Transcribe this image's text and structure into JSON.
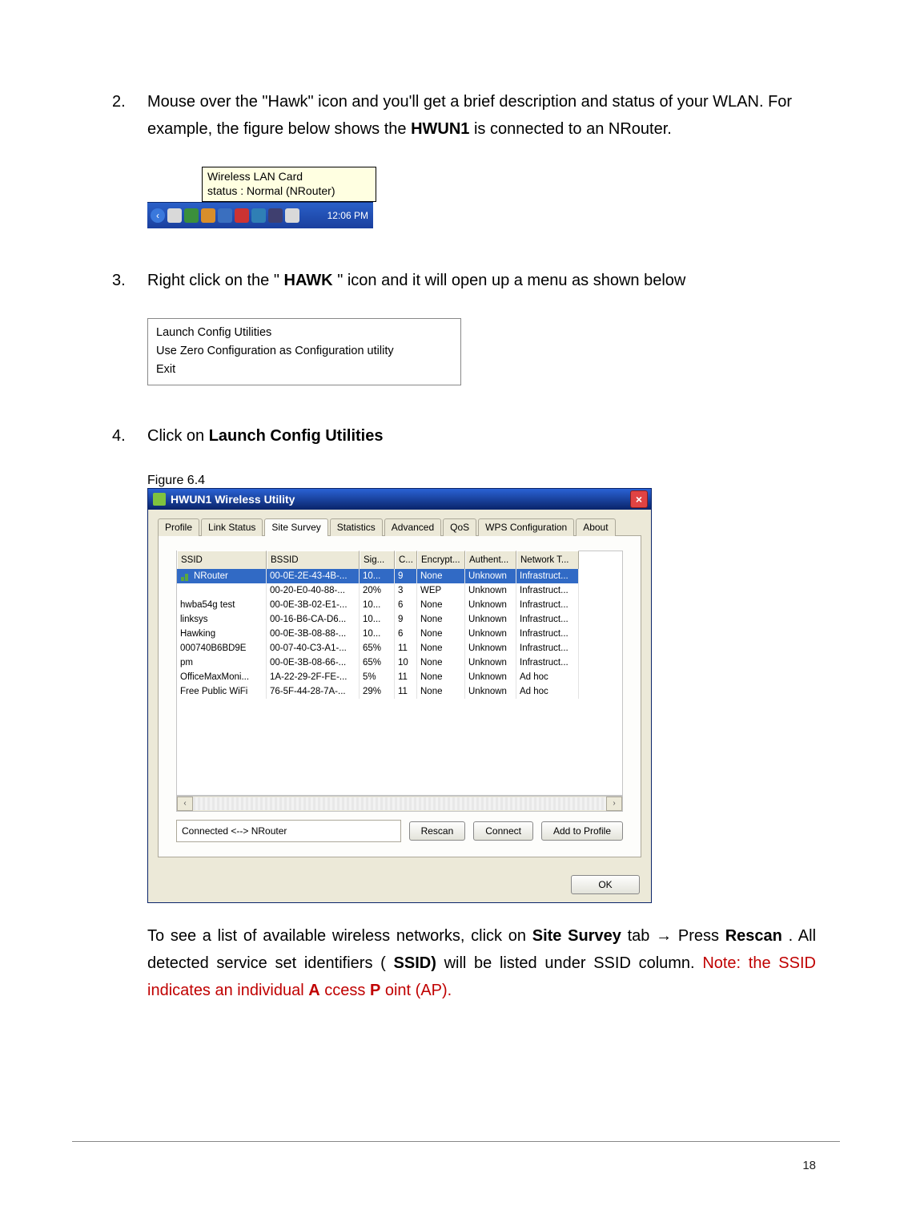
{
  "steps": {
    "s2": {
      "num": "2.",
      "text_a": "Mouse over the \"Hawk\" icon and you'll get a brief description and status of your WLAN.  For example, the figure below shows the ",
      "bold": "HWUN1",
      "text_b": " is connected to an NRouter."
    },
    "s3": {
      "num": "3.",
      "text_a": "Right click on the \"",
      "bold": "HAWK",
      "text_b": "\" icon and it will open up a menu as shown below"
    },
    "s4": {
      "num": "4.",
      "text_a": "Click on ",
      "bold": "Launch Config Utilities"
    }
  },
  "tooltip": {
    "line1": "Wireless LAN Card",
    "line2": "status : Normal (NRouter)"
  },
  "taskbar": {
    "clock": "12:06 PM",
    "tray_colors": [
      "#d9d9d9",
      "#3b8f3b",
      "#d98e2b",
      "#3a6fbf",
      "#cc3333",
      "#2f7fb5",
      "#3f3f6f",
      "#d9d9d9"
    ]
  },
  "ctx_menu": {
    "items": [
      "Launch Config Utilities",
      "Use Zero Configuration as Configuration utility",
      "Exit"
    ]
  },
  "fig_label": "Figure 6.4",
  "dialog": {
    "title": "HWUN1 Wireless Utility",
    "tabs": [
      "Profile",
      "Link Status",
      "Site Survey",
      "Statistics",
      "Advanced",
      "QoS",
      "WPS Configuration",
      "About"
    ],
    "active_tab_index": 2,
    "columns": [
      "SSID",
      "BSSID",
      "Sig...",
      "C...",
      "Encrypt...",
      "Authent...",
      "Network T..."
    ],
    "rows": [
      {
        "sel": true,
        "c": [
          "NRouter",
          "00-0E-2E-43-4B-...",
          "10...",
          "9",
          "None",
          "Unknown",
          "Infrastruct..."
        ]
      },
      {
        "sel": false,
        "c": [
          "",
          "00-20-E0-40-88-...",
          "20%",
          "3",
          "WEP",
          "Unknown",
          "Infrastruct..."
        ]
      },
      {
        "sel": false,
        "c": [
          "hwba54g test",
          "00-0E-3B-02-E1-...",
          "10...",
          "6",
          "None",
          "Unknown",
          "Infrastruct..."
        ]
      },
      {
        "sel": false,
        "c": [
          "linksys",
          "00-16-B6-CA-D6...",
          "10...",
          "9",
          "None",
          "Unknown",
          "Infrastruct..."
        ]
      },
      {
        "sel": false,
        "c": [
          "Hawking",
          "00-0E-3B-08-88-...",
          "10...",
          "6",
          "None",
          "Unknown",
          "Infrastruct..."
        ]
      },
      {
        "sel": false,
        "c": [
          "000740B6BD9E",
          "00-07-40-C3-A1-...",
          "65%",
          "11",
          "None",
          "Unknown",
          "Infrastruct..."
        ]
      },
      {
        "sel": false,
        "c": [
          "pm",
          "00-0E-3B-08-66-...",
          "65%",
          "10",
          "None",
          "Unknown",
          "Infrastruct..."
        ]
      },
      {
        "sel": false,
        "c": [
          "OfficeMaxMoni...",
          "1A-22-29-2F-FE-...",
          "5%",
          "11",
          "None",
          "Unknown",
          "Ad hoc"
        ]
      },
      {
        "sel": false,
        "c": [
          "Free Public WiFi",
          "76-5F-44-28-7A-...",
          "29%",
          "11",
          "None",
          "Unknown",
          "Ad hoc"
        ]
      }
    ],
    "status": "Connected <--> NRouter",
    "buttons": {
      "rescan": "Rescan",
      "connect": "Connect",
      "add": "Add to Profile",
      "ok": "OK"
    }
  },
  "after": {
    "a": "To see a list of available wireless networks, click on ",
    "b": "Site Survey",
    "c": " tab",
    "arrow": "→",
    "d": " Press ",
    "e": "Rescan",
    "f": ".   All detected service set identifiers (",
    "g": "SSID)",
    "h": " will be listed under SSID column.   ",
    "note_a": "Note: the SSID indicates an individual ",
    "note_b": "A",
    "note_c": "ccess ",
    "note_d": "P",
    "note_e": "oint (AP)."
  },
  "page_number": "18"
}
